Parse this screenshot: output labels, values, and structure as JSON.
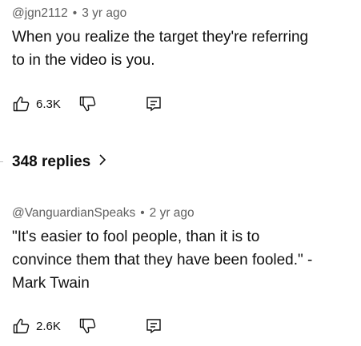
{
  "comments": [
    {
      "handle": "@jgn2112",
      "separator": "•",
      "age": "3 yr ago",
      "text_lines": [
        "When you realize the target they're referring",
        "to in the video is you."
      ],
      "likes": "6.3K"
    },
    {
      "handle": "@VanguardianSpeaks",
      "separator": "•",
      "age": "2 yr ago",
      "text_lines": [
        "\"It's easier to fool people, than it is to",
        "convince them that they have been fooled.\" -",
        "Mark Twain"
      ],
      "likes": "2.6K"
    }
  ],
  "replies": {
    "label": "348 replies",
    "chevron": "›"
  },
  "icons": {
    "like": "thumbs-up-icon",
    "dislike": "thumbs-down-icon",
    "reply": "reply-icon"
  },
  "colors": {
    "text": "#0f0f0f",
    "meta": "#606060",
    "background": "#ffffff"
  }
}
